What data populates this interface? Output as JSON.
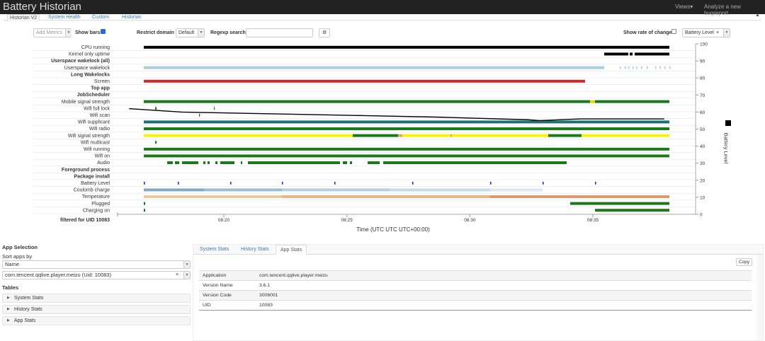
{
  "navbar": {
    "brand": "Battery Historian",
    "views": "Views▾",
    "analyze": "Analyze a new bugreport"
  },
  "top_tabs": [
    "Historian V2",
    "System Health",
    "Custom",
    "Historian"
  ],
  "controls": {
    "add_metrics": "Add Metrics",
    "show_bars_label": "Show bars",
    "show_bars_checked": true,
    "restrict_domain_label": "Restrict domain",
    "restrict_domain_value": "Default",
    "regexp_label": "Regexp search",
    "regexp_value": "",
    "rate_label": "Show rate of change",
    "rate_checked": false,
    "metric_select": "Battery Level",
    "gear_icon": "gear-icon"
  },
  "chart_data": {
    "type": "timeline",
    "xlabel": "Time (UTC UTC UTC+00:00)",
    "x_ticks": [
      "08:20",
      "08:25",
      "08:30",
      "08:35"
    ],
    "x_range": [
      "08:16:40",
      "08:40:30"
    ],
    "ylabel_right": "Battery Level",
    "y_right_range": [
      0,
      100
    ],
    "y_right_ticks": [
      0,
      10,
      20,
      30,
      40,
      50,
      60,
      70,
      80,
      90,
      100
    ],
    "battery_level_line": [
      {
        "time": "08:16:09",
        "value": 62
      },
      {
        "time": "08:18:18",
        "value": 60
      },
      {
        "time": "08:21:48",
        "value": 59
      },
      {
        "time": "08:25:20",
        "value": 58
      },
      {
        "time": "08:28:48",
        "value": 57
      },
      {
        "time": "08:32:21",
        "value": 55.5
      },
      {
        "time": "08:32:51",
        "value": 55
      },
      {
        "time": "08:34:30",
        "value": 56
      },
      {
        "time": "08:37:54",
        "value": 56
      }
    ],
    "rows": [
      {
        "name": "CPU running",
        "bold": false
      },
      {
        "name": "Kernel only uptime",
        "bold": false
      },
      {
        "name": "Userspace wakelock (all)",
        "bold": true
      },
      {
        "name": "Userspace wakelock",
        "bold": false
      },
      {
        "name": "Long Wakelocks",
        "bold": true
      },
      {
        "name": "Screen",
        "bold": false
      },
      {
        "name": "Top app",
        "bold": true
      },
      {
        "name": "JobScheduler",
        "bold": true
      },
      {
        "name": "Mobile signal strength",
        "bold": false
      },
      {
        "name": "Wifi full lock",
        "bold": false
      },
      {
        "name": "Wifi scan",
        "bold": false
      },
      {
        "name": "Wifi supplicant",
        "bold": false
      },
      {
        "name": "Wifi radio",
        "bold": false
      },
      {
        "name": "Wifi signal strength",
        "bold": false
      },
      {
        "name": "Wifi multicast",
        "bold": false
      },
      {
        "name": "Wifi running",
        "bold": false
      },
      {
        "name": "Wifi on",
        "bold": false
      },
      {
        "name": "Audio",
        "bold": false
      },
      {
        "name": "Foreground process",
        "bold": true
      },
      {
        "name": "Package install",
        "bold": true
      },
      {
        "name": "Battery Level",
        "bold": false
      },
      {
        "name": "Coulomb charge",
        "bold": false
      },
      {
        "name": "Temperature",
        "bold": false
      },
      {
        "name": "Plugged",
        "bold": false
      },
      {
        "name": "Charging on",
        "bold": false
      }
    ],
    "filter_label": "filtered for UID 10083"
  },
  "colors": {
    "black": "#000000",
    "red": "#d62728",
    "green": "#1a7a1a",
    "teal": "#1f6f78",
    "yellow": "#f5f500",
    "light_blue": "#a9cde3",
    "orange": "#e8a070",
    "blue": "#1f1fd6"
  },
  "app_selection": {
    "title": "App Selection",
    "sort_label": "Sort apps by",
    "sort_value": "Name",
    "app_value": "com.tencent.qqlive.player.meizu (Uid: 10083)",
    "tables_title": "Tables",
    "tables": [
      "System Stats",
      "History Stats",
      "App Stats"
    ]
  },
  "stats": {
    "tabs": [
      "System Stats",
      "History Stats",
      "App Stats"
    ],
    "copy_label": "Copy",
    "rows": [
      {
        "key": "Application",
        "value": "com.tencent.qqlive.player.meizu"
      },
      {
        "key": "Version Name",
        "value": "3.6.1"
      },
      {
        "key": "Version Code",
        "value": "3006001"
      },
      {
        "key": "UID",
        "value": "10083"
      }
    ]
  }
}
